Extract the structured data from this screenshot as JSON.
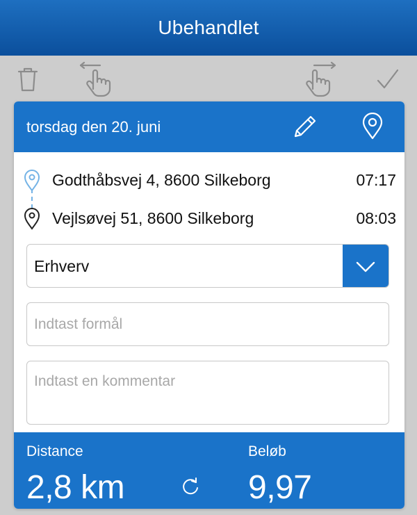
{
  "nav": {
    "title": "Ubehandlet"
  },
  "toolbar": {
    "delete_icon": "trash-icon",
    "swipe_left_icon": "swipe-left-hand-icon",
    "swipe_right_icon": "swipe-right-hand-icon",
    "approve_icon": "checkmark-icon"
  },
  "trip": {
    "date": "torsdag den 20. juni",
    "edit_icon": "pencil-icon",
    "map_icon": "location-pin-icon",
    "start": {
      "address": "Godthåbsvej 4, 8600 Silkeborg",
      "time": "07:17"
    },
    "end": {
      "address": "Vejlsøvej 51, 8600 Silkeborg",
      "time": "08:03"
    },
    "category": {
      "selected": "Erhverv"
    },
    "purpose": {
      "placeholder": "Indtast formål",
      "value": ""
    },
    "comment": {
      "placeholder": "Indtast en kommentar",
      "value": ""
    },
    "footer": {
      "distance_label": "Distance",
      "distance_value": "2,8 km",
      "amount_label": "Beløb",
      "amount_value": "9,97"
    }
  },
  "colors": {
    "primary": "#1a73c9",
    "navbar": "#0b4f9c",
    "background": "#cdcdcd"
  }
}
